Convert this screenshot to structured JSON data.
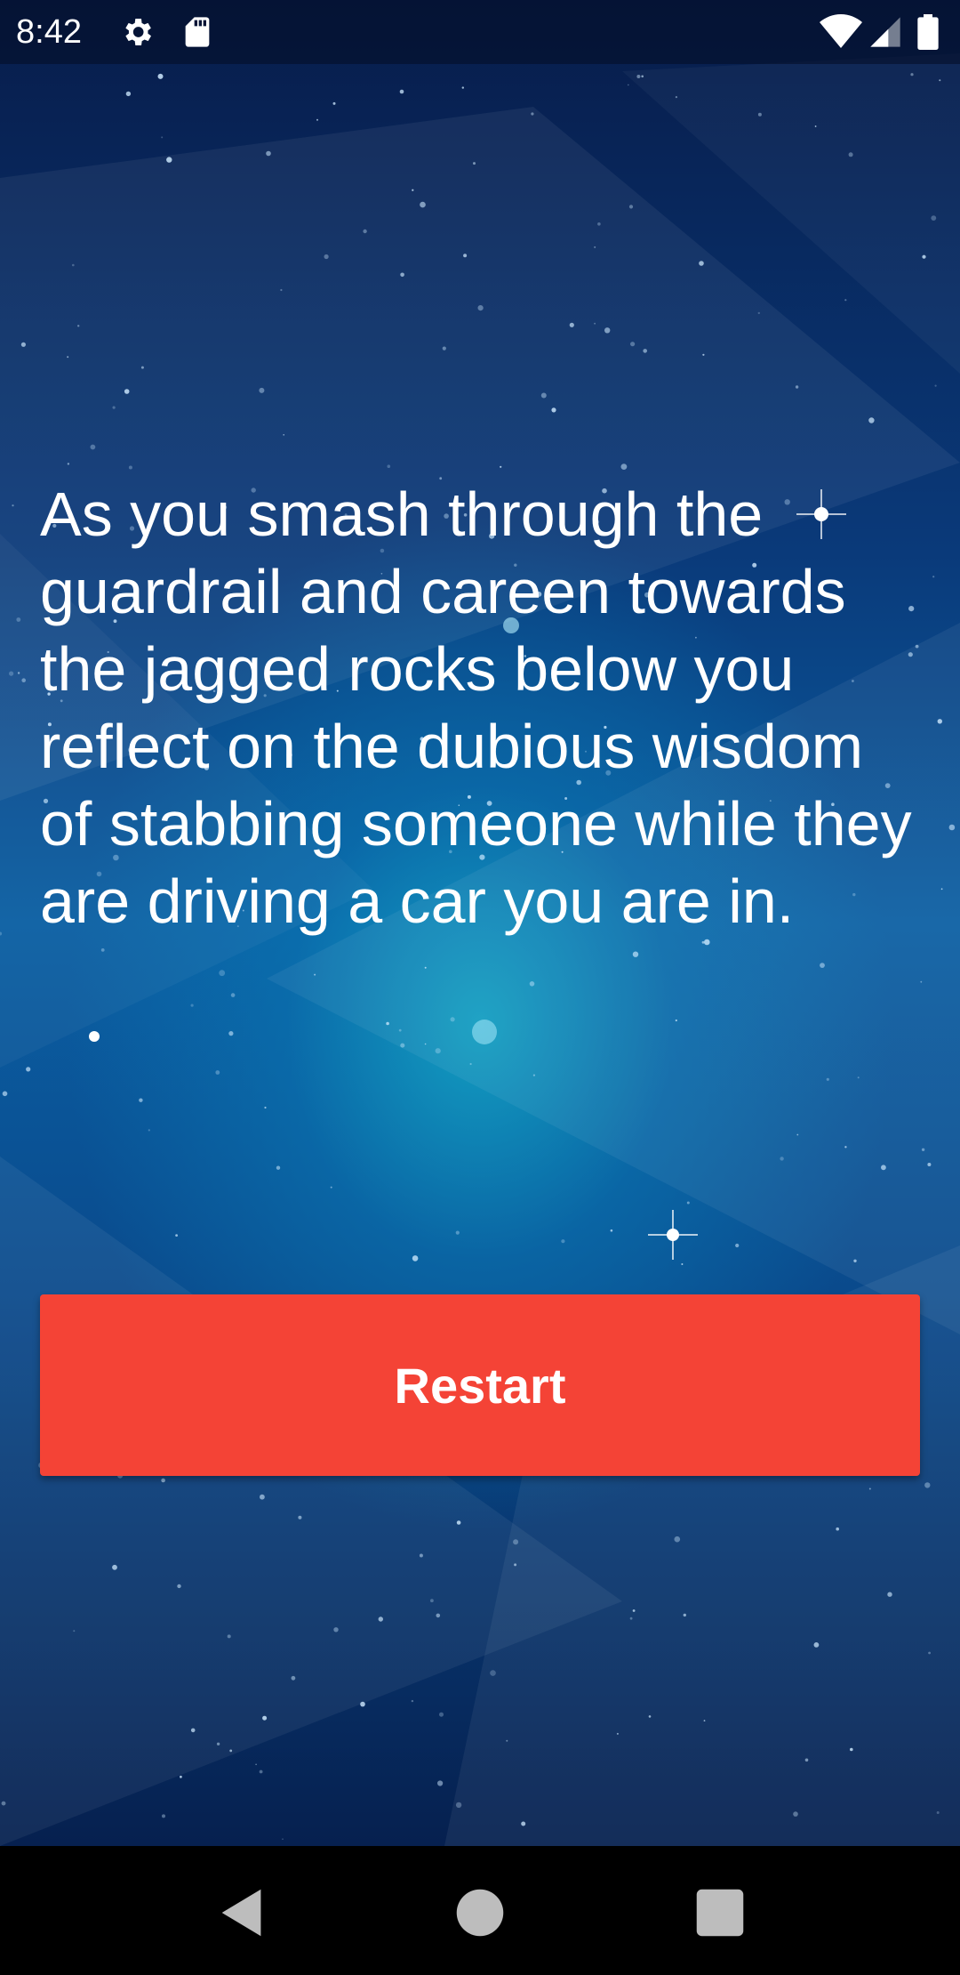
{
  "status_bar": {
    "time": "8:42",
    "icons": [
      "gear-icon",
      "sdcard-icon",
      "wifi-icon",
      "signal-icon",
      "battery-icon"
    ]
  },
  "story": {
    "text": "As you smash through the guardrail and careen towards the jagged rocks below you reflect on the dubious wisdom of stabbing someone while they are driving a car you are in."
  },
  "actions": {
    "restart_label": "Restart"
  },
  "nav_bar": {
    "icons": [
      "back-icon",
      "home-icon",
      "recents-icon"
    ]
  },
  "colors": {
    "button": "#f44336",
    "text": "#ffffff",
    "background_top": "#071c4a",
    "background_center": "#0b5fa3"
  }
}
